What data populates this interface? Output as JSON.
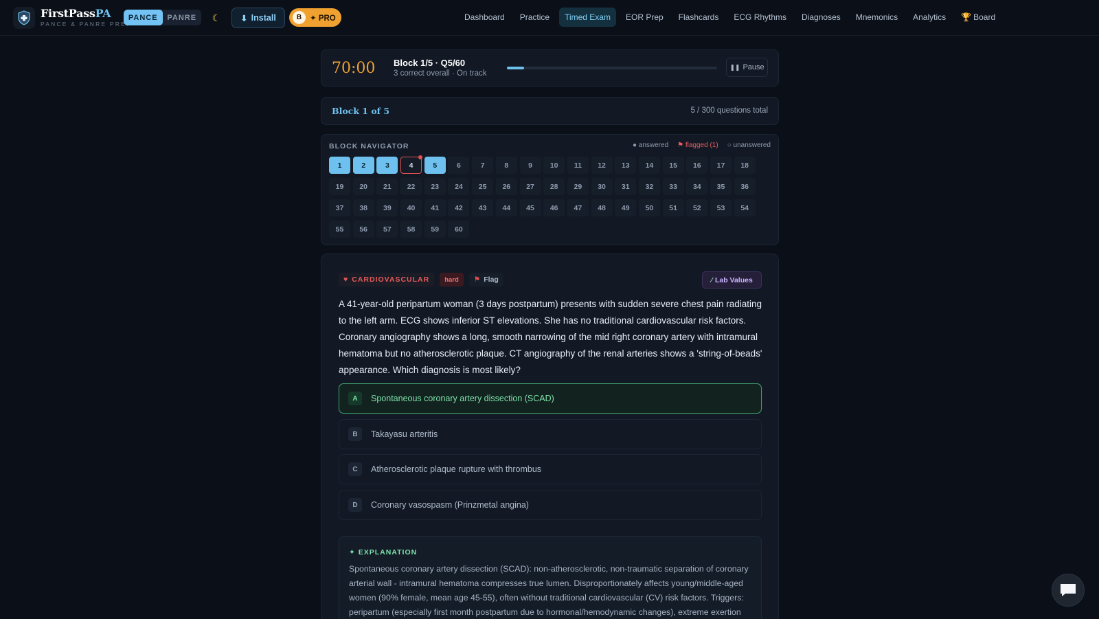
{
  "brand": {
    "name": "FirstPass",
    "name_accent": "PA",
    "subtitle": "PANCE & PANRE PREP"
  },
  "mode_toggle": {
    "options": [
      "PANCE",
      "PANRE"
    ],
    "selected": "PANCE"
  },
  "header": {
    "install_label": "Install",
    "pro_avatar": "B",
    "pro_label": "✦ PRO"
  },
  "nav": {
    "items": [
      "Dashboard",
      "Practice",
      "Timed Exam",
      "EOR Prep",
      "Flashcards",
      "ECG Rhythms",
      "Diagnoses",
      "Mnemonics",
      "Analytics",
      "Board"
    ],
    "active": "Timed Exam"
  },
  "timer": {
    "time": "70:00",
    "block_label": "Block 1/5 · Q5/60",
    "status": "3 correct overall · On track",
    "progress_fraction": 0.0833,
    "pause_label": "Pause"
  },
  "block": {
    "title": "Block 1 of 5",
    "total": "5 / 300 questions total"
  },
  "navigator": {
    "heading": "BLOCK NAVIGATOR",
    "legend": {
      "answered": "answered",
      "flagged": "flagged (1)",
      "unanswered": "unanswered"
    },
    "count": 60,
    "answered": [
      1,
      2,
      3,
      5
    ],
    "flagged": [
      4
    ]
  },
  "question": {
    "category": "CARDIOVASCULAR",
    "difficulty": "hard",
    "flag_label": "Flag",
    "lab_values_label": "Lab Values",
    "stem": "A 41-year-old peripartum woman (3 days postpartum) presents with sudden severe chest pain radiating to the left arm. ECG shows inferior ST elevations. She has no traditional cardiovascular risk factors. Coronary angiography shows a long, smooth narrowing of the mid right coronary artery with intramural hematoma but no atherosclerotic plaque. CT angiography of the renal arteries shows a 'string-of-beads' appearance. Which diagnosis is most likely?",
    "options": [
      {
        "letter": "A",
        "text": "Spontaneous coronary artery dissection (SCAD)",
        "state": "correct"
      },
      {
        "letter": "B",
        "text": "Takayasu arteritis",
        "state": "neutral"
      },
      {
        "letter": "C",
        "text": "Atherosclerotic plaque rupture with thrombus",
        "state": "neutral"
      },
      {
        "letter": "D",
        "text": "Coronary vasospasm (Prinzmetal angina)",
        "state": "neutral"
      }
    ]
  },
  "explanation": {
    "heading": "✦ EXPLANATION",
    "text": "Spontaneous coronary artery dissection (SCAD): non-atherosclerotic, non-traumatic separation of coronary arterial wall - intramural hematoma compresses true lumen. Disproportionately affects young/middle-aged women (90% female, mean age 45-55), often without traditional cardiovascular (CV) risk factors. Triggers: peripartum (especially first month postpartum due to hormonal/hemodynamic changes), extreme exertion"
  },
  "colors": {
    "accent": "#6ec1ee",
    "timer": "#f0a130",
    "correct": "#7ee3ab",
    "flag": "#e25050",
    "background": "#0b1018"
  }
}
